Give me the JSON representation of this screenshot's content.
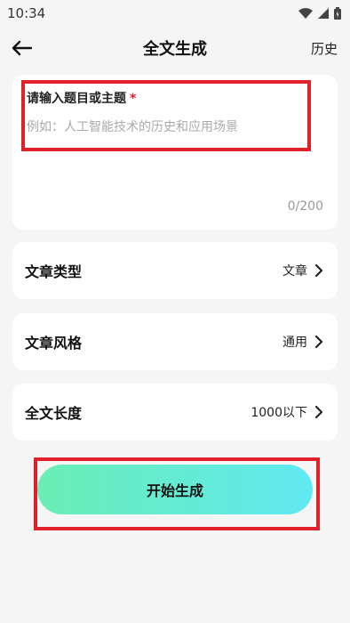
{
  "status_bar": {
    "time": "10:34"
  },
  "header": {
    "title": "全文生成",
    "history_label": "历史"
  },
  "topic": {
    "label": "请输入题目或主题",
    "required_mark": "*",
    "placeholder": "例如：人工智能技术的历史和应用场景",
    "value": "",
    "char_count": "0/200"
  },
  "options": [
    {
      "label": "文章类型",
      "value": "文章"
    },
    {
      "label": "文章风格",
      "value": "通用"
    },
    {
      "label": "全文长度",
      "value": "1000以下"
    }
  ],
  "start_button": {
    "label": "开始生成"
  },
  "colors": {
    "highlight": "#e0202a",
    "button_gradient_start": "#6aeeb5",
    "button_gradient_end": "#5fe9f2",
    "background": "#f5f5f5"
  }
}
